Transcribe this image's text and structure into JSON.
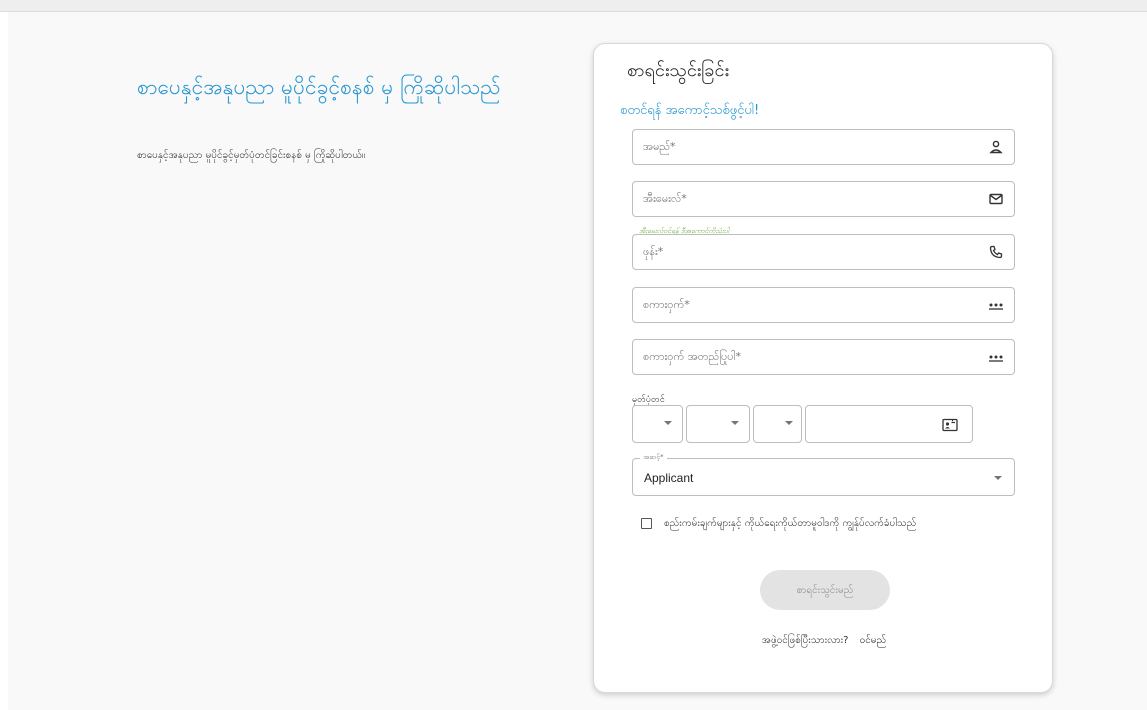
{
  "left": {
    "welcome_title": "စာပေနှင့်အနုပညာ မူပိုင်ခွင့်စနစ် မှ ကြိုဆိုပါသည်",
    "welcome_subtitle": "စာပေနှင့်အနုပညာ မူပိုင်ခွင့်မှတ်ပုံတင်ခြင်းစနစ် မှ ကြိုဆိုပါတယ်။"
  },
  "card": {
    "title": "စာရင်းသွင်းခြင်း",
    "subtitle": "စတင်ရန် အကောင့်သစ်ဖွင့်ပါ!"
  },
  "form": {
    "name_label": "အမည်*",
    "email_label": "အီးမေးလ်*",
    "email_helper": "အီးမေးလ်ဝင်ရန် ဒီအကောင့်ကိုသုံးပါ",
    "phone_label": "ဖုန်း*",
    "password_label": "စကားဝှက်*",
    "confirm_password_label": "စကားဝှက် အတည်ပြုပါ*",
    "nrc_label": "မှတ်ပုံတင်",
    "role_label": "အဆင့်*",
    "role_value": "Applicant",
    "terms_label": "စည်းကမ်းချက်များနှင့် ကိုယ်ရေးကိုယ်တာမူဝါဒကို ကျွန်ုပ်လက်ခံပါသည်",
    "register_button": "စာရင်းသွင်းမည်",
    "login_prompt": "အဖွဲ့ဝင်ဖြစ်ပြီးသားလား?",
    "login_link": "ဝင်မည်"
  },
  "icons": {
    "name": "person-icon",
    "email": "mail-icon",
    "phone": "phone-icon",
    "password": "password-dots-icon",
    "nrc": "id-card-icon"
  },
  "colors": {
    "accent": "#2596d1",
    "helper": "#6aaa3a",
    "button_disabled_bg": "#e3e3e3",
    "border": "#bdbdbd"
  }
}
